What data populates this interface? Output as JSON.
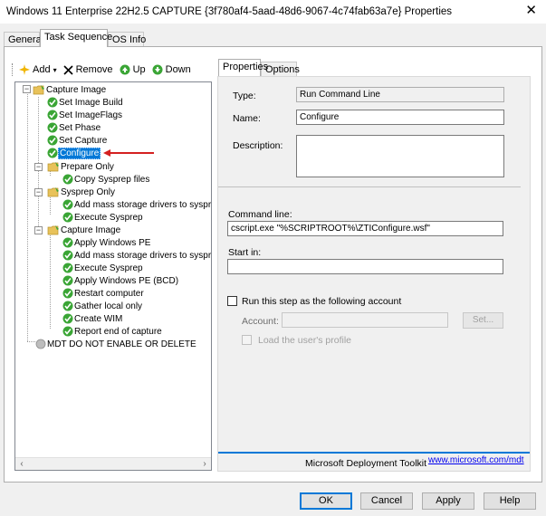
{
  "window": {
    "title": "Windows 11 Enterprise 22H2.5 CAPTURE {3f780af4-5aad-48d6-9067-4c74fab63a7e} Properties",
    "close_glyph": "✕"
  },
  "tabs": [
    {
      "label": "General",
      "active": false
    },
    {
      "label": "Task Sequence",
      "active": true
    },
    {
      "label": "OS Info",
      "active": false
    }
  ],
  "toolbar": {
    "add": "Add",
    "remove": "Remove",
    "up": "Up",
    "down": "Down"
  },
  "tree": [
    {
      "label": "Capture Image",
      "type": "folder",
      "expanded": true
    },
    {
      "label": "Set Image Build",
      "type": "step"
    },
    {
      "label": "Set ImageFlags",
      "type": "step"
    },
    {
      "label": "Set Phase",
      "type": "step"
    },
    {
      "label": "Set Capture",
      "type": "step"
    },
    {
      "label": "Configure",
      "type": "step",
      "selected": true
    },
    {
      "label": "Prepare Only",
      "type": "folder",
      "expanded": true
    },
    {
      "label": "Copy Sysprep files",
      "type": "step"
    },
    {
      "label": "Sysprep Only",
      "type": "folder",
      "expanded": true
    },
    {
      "label": "Add mass storage drivers to sysprep.ir",
      "type": "step"
    },
    {
      "label": "Execute Sysprep",
      "type": "step"
    },
    {
      "label": "Capture Image",
      "type": "folder",
      "expanded": true
    },
    {
      "label": "Apply Windows PE",
      "type": "step"
    },
    {
      "label": "Add mass storage drivers to sysprep.ir",
      "type": "step"
    },
    {
      "label": "Execute Sysprep",
      "type": "step"
    },
    {
      "label": "Apply Windows PE (BCD)",
      "type": "step"
    },
    {
      "label": "Restart computer",
      "type": "step"
    },
    {
      "label": "Gather local only",
      "type": "step"
    },
    {
      "label": "Create WIM",
      "type": "step"
    },
    {
      "label": "Report end of capture",
      "type": "step"
    },
    {
      "label": "MDT DO NOT ENABLE OR DELETE",
      "type": "disabled"
    }
  ],
  "right_tabs": [
    {
      "label": "Properties",
      "active": true
    },
    {
      "label": "Options",
      "active": false
    }
  ],
  "properties": {
    "type_label": "Type:",
    "type_value": "Run Command Line",
    "name_label": "Name:",
    "name_value": "Configure",
    "description_label": "Description:",
    "description_value": "",
    "command_line_label": "Command line:",
    "command_line_value": "cscript.exe \"%SCRIPTROOT%\\ZTIConfigure.wsf\"",
    "start_in_label": "Start in:",
    "start_in_value": "",
    "run_as_label": "Run this step as the following account",
    "account_label": "Account:",
    "account_value": "",
    "set_button": "Set...",
    "load_profile_label": "Load the user's profile"
  },
  "footer": {
    "text": "Microsoft Deployment Toolkit",
    "link": "www.microsoft.com/mdt"
  },
  "buttons": {
    "ok": "OK",
    "cancel": "Cancel",
    "apply": "Apply",
    "help": "Help"
  },
  "colors": {
    "selection": "#0078d7",
    "step_check": "#3aa535",
    "folder": "#e8c25a",
    "arrow": "#d42020"
  }
}
